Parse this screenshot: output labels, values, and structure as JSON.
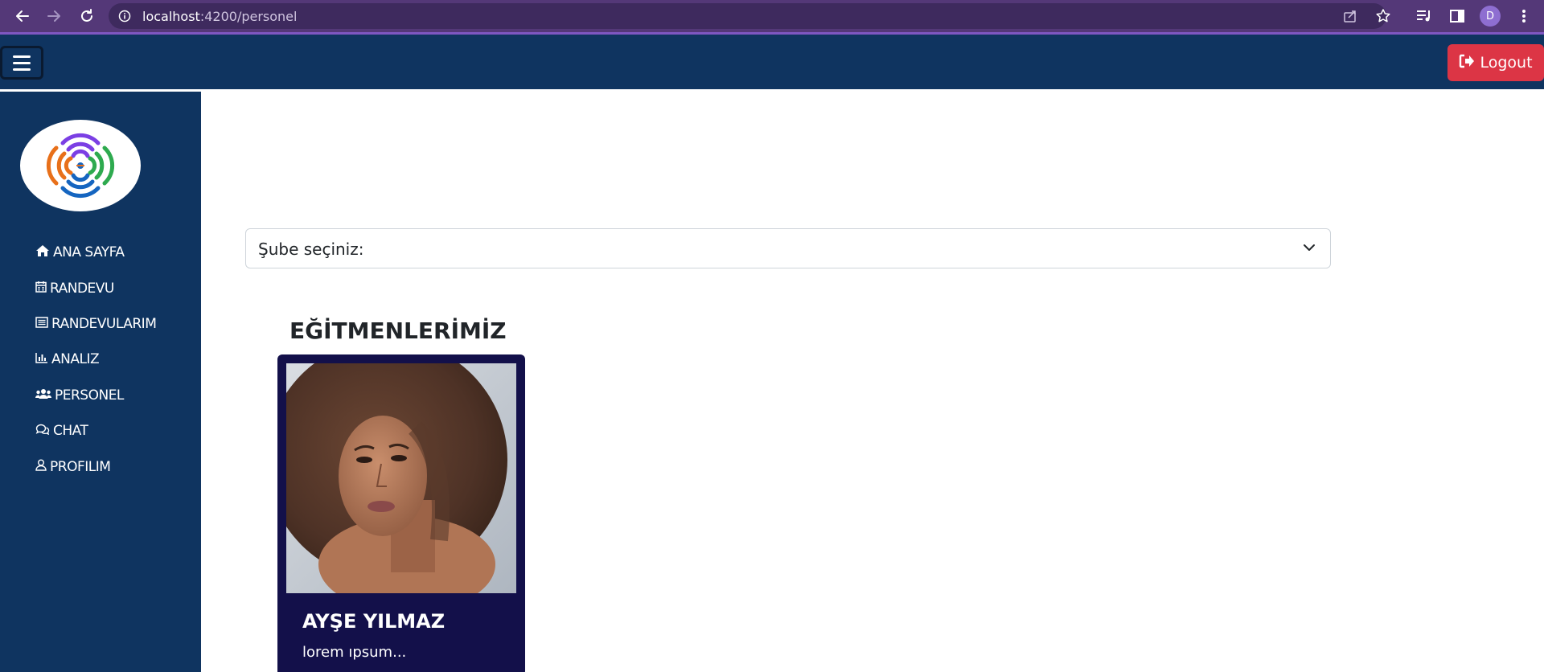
{
  "browser": {
    "url_host": "localhost",
    "url_path": ":4200/personel",
    "profile_initial": "D"
  },
  "header": {
    "logout_label": "Logout"
  },
  "sidebar": {
    "items": [
      {
        "label": "ANA SAYFA",
        "icon": "home-icon"
      },
      {
        "label": "RANDEVU",
        "icon": "calendar-icon"
      },
      {
        "label": "RANDEVULARıM",
        "icon": "list-icon"
      },
      {
        "label": "ANALıZ",
        "icon": "chart-icon"
      },
      {
        "label": "PERSONEL",
        "icon": "users-icon"
      },
      {
        "label": "CHAT",
        "icon": "chat-icon"
      },
      {
        "label": "PROFıLıM",
        "icon": "user-icon"
      }
    ]
  },
  "main": {
    "branch_select_label": "Şube seçiniz:",
    "section_title": "EĞİTMENLERİMİZ",
    "trainers": [
      {
        "name": "AYŞE YILMAZ",
        "description": "lorem ıpsum..."
      }
    ]
  },
  "colors": {
    "browser_bar": "#543878",
    "header": "#0f3460",
    "sidebar": "#0f3460",
    "logout": "#dc3545",
    "card": "#13104a"
  }
}
